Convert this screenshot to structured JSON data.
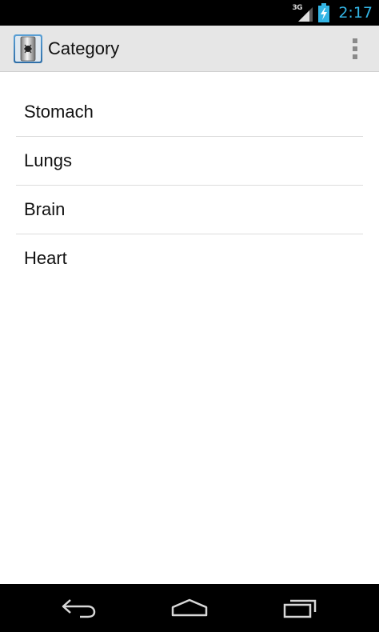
{
  "status_bar": {
    "network_type": "3G",
    "time": "2:17",
    "icons": [
      "signal-icon",
      "battery-charging-icon"
    ]
  },
  "action_bar": {
    "title": "Category",
    "app_icon": "app-logo-icon",
    "overflow_icon": "overflow-menu-icon"
  },
  "categories": [
    {
      "label": "Stomach"
    },
    {
      "label": "Lungs"
    },
    {
      "label": "Brain"
    },
    {
      "label": "Heart"
    }
  ],
  "nav_bar": {
    "icons": [
      "back-icon",
      "home-icon",
      "recents-icon"
    ]
  },
  "colors": {
    "status_bar_bg": "#000000",
    "clock": "#33b5e5",
    "action_bar_bg": "#e6e6e6",
    "list_divider": "#dcdcdc",
    "nav_bar_bg": "#000000"
  }
}
